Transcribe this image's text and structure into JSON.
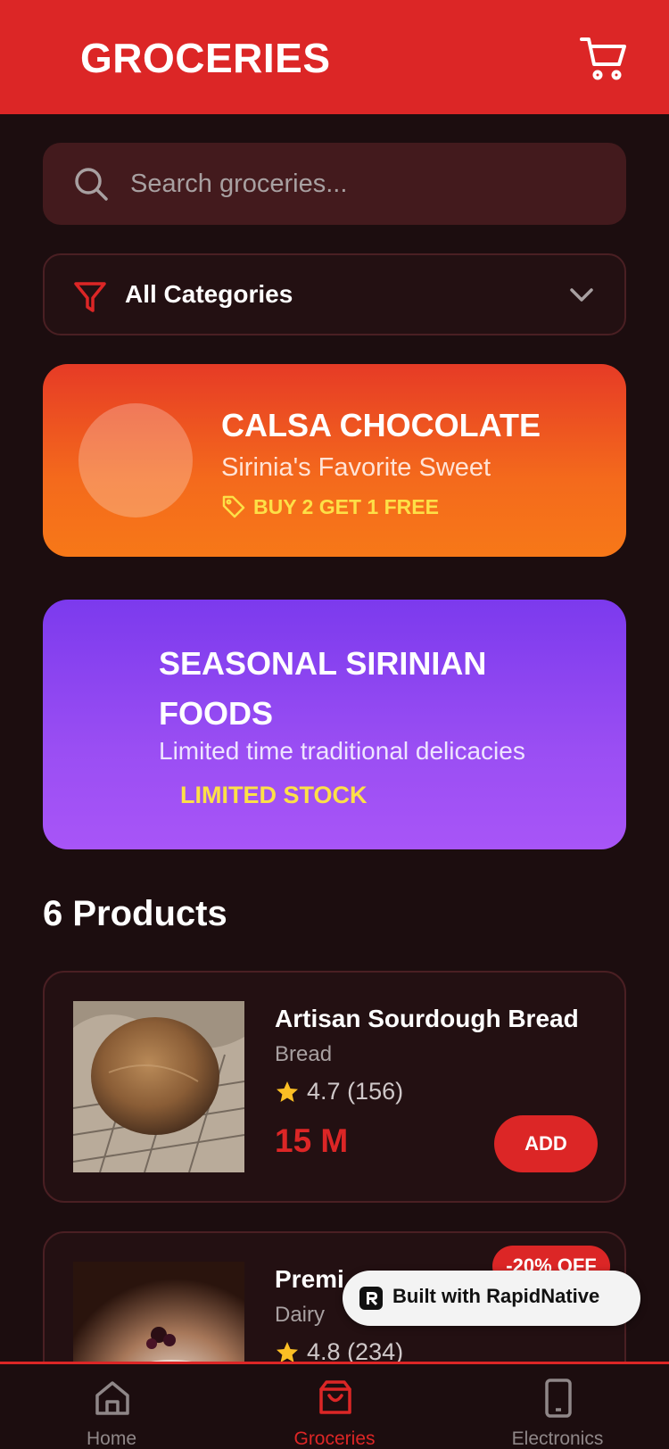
{
  "header": {
    "title": "GROCERIES",
    "cart_icon": "cart-icon"
  },
  "search": {
    "placeholder": "Search groceries...",
    "value": "",
    "icon": "search-icon"
  },
  "category_filter": {
    "selected": "All Categories",
    "icon": "filter-icon",
    "chevron_icon": "chevron-down-icon"
  },
  "promos": [
    {
      "title": "CALSA CHOCOLATE",
      "subtitle": "Sirinia's Favorite Sweet",
      "tag": "BUY 2 GET 1 FREE",
      "tag_icon": "tag-icon",
      "colors": [
        "#e63b26",
        "#f77818"
      ]
    },
    {
      "title": "SEASONAL SIRINIAN FOODS",
      "subtitle": "Limited time traditional delicacies",
      "tag": "LIMITED STOCK",
      "colors": [
        "#7c3aed",
        "#a855f7"
      ]
    }
  ],
  "products_count_label": "6 Products",
  "products": [
    {
      "name": "Artisan Sourdough Bread",
      "category": "Bread",
      "rating": "4.7",
      "reviews": "(156)",
      "price": "15 M",
      "add_label": "ADD"
    },
    {
      "name": "Premi",
      "category": "Dairy",
      "rating": "4.8",
      "reviews": "(234)",
      "badge": "-20% OFF"
    }
  ],
  "built_with": {
    "label": "Built with RapidNative",
    "icon": "rapidnative-logo-icon"
  },
  "tabs": [
    {
      "label": "Home",
      "icon": "home-icon",
      "active": false
    },
    {
      "label": "Groceries",
      "icon": "shopping-bag-icon",
      "active": true
    },
    {
      "label": "Electronics",
      "icon": "phone-icon",
      "active": false
    }
  ],
  "colors": {
    "brand": "#dc2626",
    "background": "#1c0d0f",
    "highlight": "#fde047",
    "star": "#fbbf24"
  }
}
